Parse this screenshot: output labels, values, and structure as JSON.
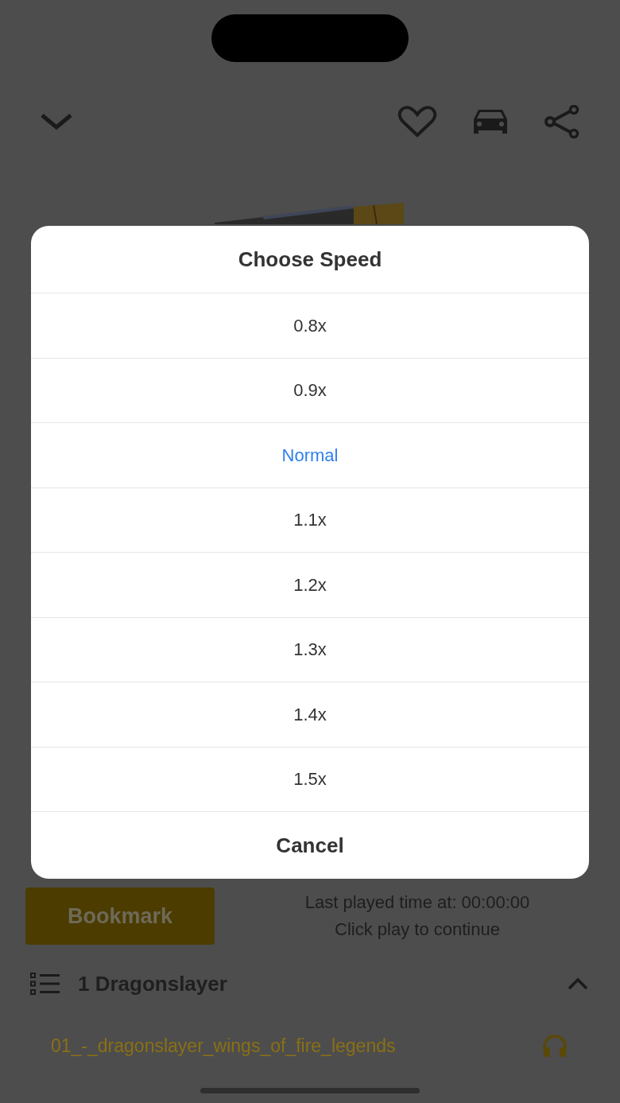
{
  "speed_dialog": {
    "title": "Choose Speed",
    "options": [
      {
        "label": "0.8x",
        "selected": false
      },
      {
        "label": "0.9x",
        "selected": false
      },
      {
        "label": "Normal",
        "selected": true
      },
      {
        "label": "1.1x",
        "selected": false
      },
      {
        "label": "1.2x",
        "selected": false
      },
      {
        "label": "1.3x",
        "selected": false
      },
      {
        "label": "1.4x",
        "selected": false
      },
      {
        "label": "1.5x",
        "selected": false
      }
    ],
    "cancel": "Cancel"
  },
  "bookmark_button": "Bookmark",
  "last_played": "Last played time at: 00:00:00",
  "hint": "Click play to continue",
  "chapter": {
    "title": "1 Dragonslayer",
    "expanded": true,
    "tracks": [
      {
        "title": "01_-_dragonslayer_wings_of_fire_legends"
      }
    ]
  }
}
